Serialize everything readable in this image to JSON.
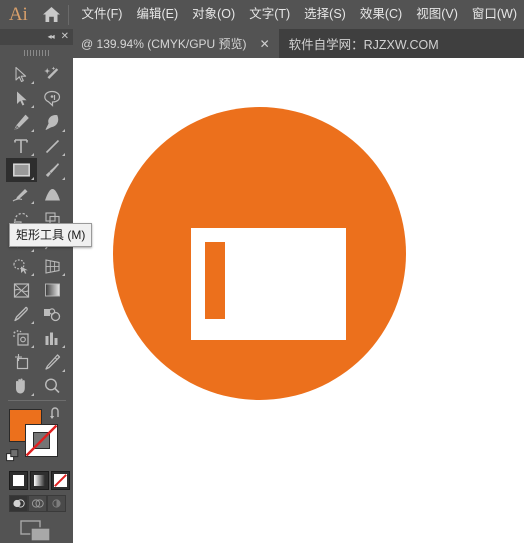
{
  "app": {
    "name": "Ai",
    "logo_color": "#d9a06b",
    "home_icon": "home-icon"
  },
  "menubar": {
    "items": [
      {
        "label": "文件(F)"
      },
      {
        "label": "编辑(E)"
      },
      {
        "label": "对象(O)"
      },
      {
        "label": "文字(T)"
      },
      {
        "label": "选择(S)"
      },
      {
        "label": "效果(C)"
      },
      {
        "label": "视图(V)"
      },
      {
        "label": "窗口(W)"
      }
    ]
  },
  "tabbar": {
    "document_tab": {
      "label": "@ 139.94% (CMYK/GPU 预览)",
      "zoom": "139.94%",
      "color_mode": "CMYK/GPU 预览",
      "close_icon": "✕"
    },
    "watermark": "软件自学网：RJZXW.COM"
  },
  "toolbar": {
    "header": {
      "collapse_icon": "◂◂",
      "close_icon": "✕"
    },
    "tools": [
      {
        "name": "selection-tool",
        "label": "选择工具",
        "selected": false,
        "has_flyout": true
      },
      {
        "name": "magic-wand-tool",
        "label": "魔棒工具",
        "selected": false,
        "has_flyout": false
      },
      {
        "name": "direct-selection-tool",
        "label": "直接选择工具",
        "selected": false,
        "has_flyout": true
      },
      {
        "name": "lasso-tool",
        "label": "套索工具",
        "selected": false,
        "has_flyout": false
      },
      {
        "name": "pen-tool",
        "label": "钢笔工具",
        "selected": false,
        "has_flyout": true
      },
      {
        "name": "curvature-tool",
        "label": "曲率工具",
        "selected": false,
        "has_flyout": true
      },
      {
        "name": "type-tool",
        "label": "文字工具",
        "selected": false,
        "has_flyout": true
      },
      {
        "name": "line-segment-tool",
        "label": "直线段工具",
        "selected": false,
        "has_flyout": true
      },
      {
        "name": "rectangle-tool",
        "label": "矩形工具",
        "selected": true,
        "has_flyout": true
      },
      {
        "name": "paintbrush-tool",
        "label": "画笔工具",
        "selected": false,
        "has_flyout": true
      },
      {
        "name": "shaper-tool",
        "label": "Shaper 工具",
        "selected": false,
        "has_flyout": true
      },
      {
        "name": "blob-brush-tool",
        "label": "斑点画笔工具",
        "selected": false,
        "has_flyout": false
      },
      {
        "name": "eraser-tool",
        "label": "橡皮擦工具",
        "selected": false,
        "has_flyout": true
      },
      {
        "name": "free-transform-tool",
        "label": "自由变换工具",
        "selected": false,
        "has_flyout": true
      },
      {
        "name": "rotate-tool",
        "label": "旋转工具",
        "selected": false,
        "has_flyout": true
      },
      {
        "name": "puppet-warp-tool",
        "label": "操控变形工具",
        "selected": false,
        "has_flyout": false
      },
      {
        "name": "shape-builder-tool",
        "label": "形状生成器",
        "selected": false,
        "has_flyout": true
      },
      {
        "name": "perspective-grid-tool",
        "label": "透视网格工具",
        "selected": false,
        "has_flyout": true
      },
      {
        "name": "mesh-tool",
        "label": "网格工具",
        "selected": false,
        "has_flyout": false
      },
      {
        "name": "gradient-tool",
        "label": "渐变工具",
        "selected": false,
        "has_flyout": false
      },
      {
        "name": "eyedropper-tool",
        "label": "吸管工具",
        "selected": false,
        "has_flyout": true
      },
      {
        "name": "blend-tool",
        "label": "混合工具",
        "selected": false,
        "has_flyout": false
      },
      {
        "name": "symbol-sprayer-tool",
        "label": "符号喷枪工具",
        "selected": false,
        "has_flyout": true
      },
      {
        "name": "column-graph-tool",
        "label": "柱形图工具",
        "selected": false,
        "has_flyout": true
      },
      {
        "name": "artboard-tool",
        "label": "画板工具",
        "selected": false,
        "has_flyout": false
      },
      {
        "name": "slice-tool",
        "label": "切片工具",
        "selected": false,
        "has_flyout": true
      },
      {
        "name": "hand-tool",
        "label": "抓手工具",
        "selected": false,
        "has_flyout": true
      },
      {
        "name": "zoom-tool",
        "label": "缩放工具",
        "selected": false,
        "has_flyout": false
      }
    ],
    "tooltip": {
      "text": "矩形工具 (M)",
      "visible": true
    },
    "colors": {
      "fill": "#ec701c",
      "stroke": "none",
      "stroke_display": "#ffffff",
      "swap_icon": "swap-fill-stroke-icon",
      "default_icon": "default-fill-stroke-icon"
    },
    "fill_types": [
      {
        "name": "color-fill-button",
        "active": false
      },
      {
        "name": "gradient-fill-button",
        "active": false
      },
      {
        "name": "none-fill-button",
        "active": true
      }
    ],
    "draw_modes": [
      {
        "name": "draw-normal-button",
        "active": true
      },
      {
        "name": "draw-behind-button",
        "active": false
      },
      {
        "name": "draw-inside-button",
        "active": false
      }
    ],
    "screen_mode": {
      "name": "change-screen-mode-button"
    }
  },
  "canvas": {
    "background": "#ffffff",
    "artwork": {
      "circle": {
        "color": "#ec701c",
        "shape": "circle"
      },
      "white_rectangle": {
        "color": "#ffffff",
        "shape": "rectangle"
      },
      "orange_bar": {
        "color": "#ec701c",
        "shape": "rectangle"
      }
    }
  }
}
